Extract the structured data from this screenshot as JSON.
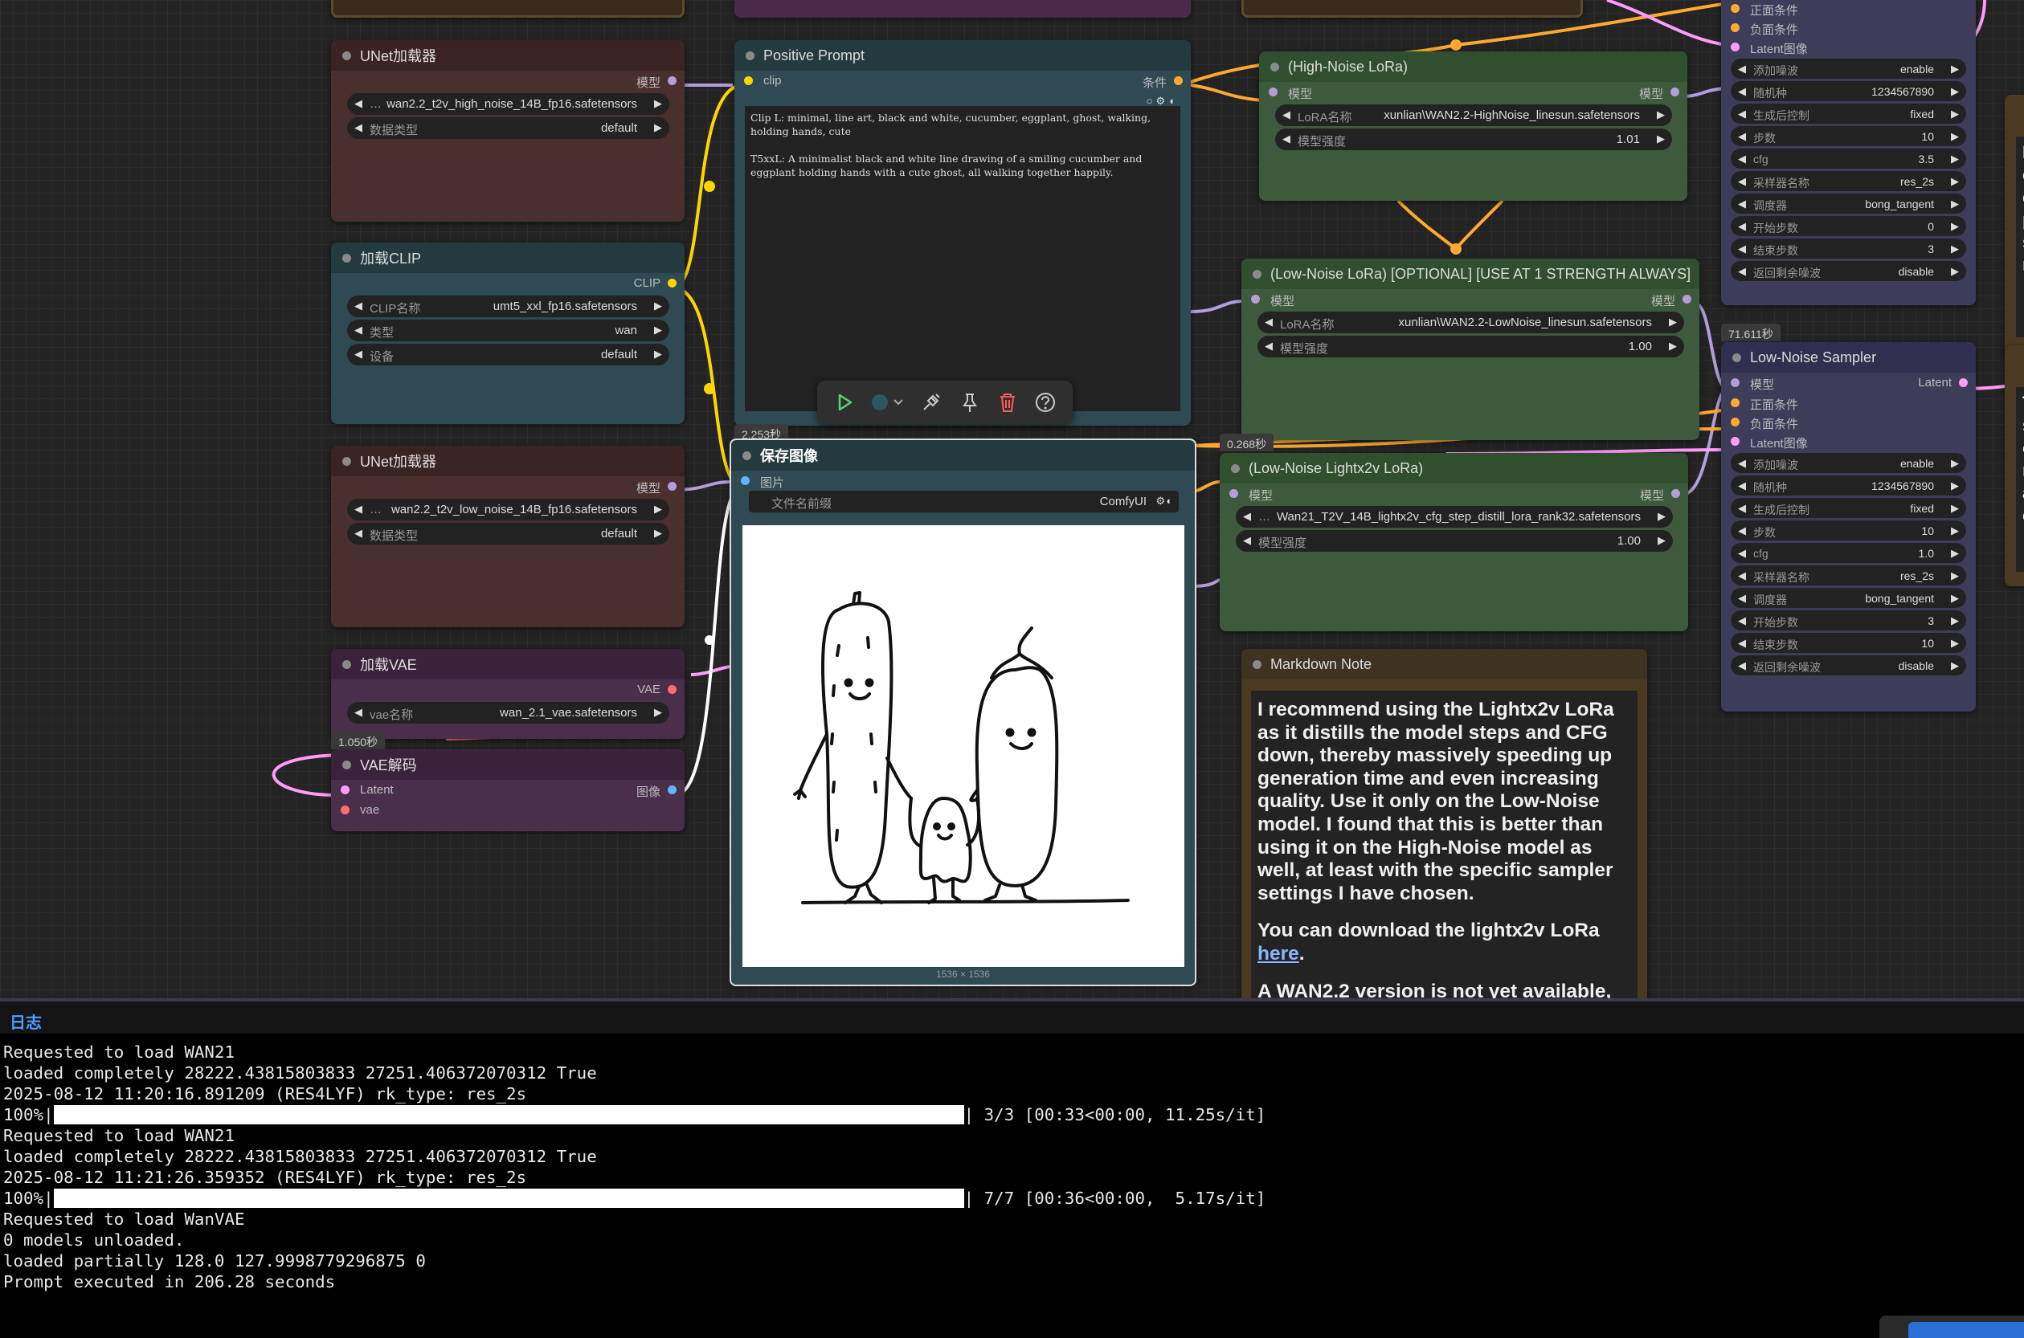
{
  "colors": {
    "clip": "#ffd500",
    "model": "#b39ddb",
    "conditioning": "#ffa931",
    "latent": "#ff9cf9",
    "vae": "#ff6e6e",
    "image": "#64b5f6",
    "green_node": "#2f4f2f",
    "purple_node": "#2f2f4f",
    "red_node": "#3a2323",
    "teal_node": "#233a3f"
  },
  "nodes": {
    "unet_high": {
      "title": "UNet加载器",
      "out_model": "模型",
      "unet_name": "wan2.2_t2v_high_noise_14B_fp16.safetensors",
      "dtype_label": "数据类型",
      "dtype": "default"
    },
    "clip_loader": {
      "title": "加载CLIP",
      "out_clip": "CLIP",
      "clip_name_label": "CLIP名称",
      "clip_name": "umt5_xxl_fp16.safetensors",
      "type_label": "类型",
      "type": "wan",
      "device_label": "设备",
      "device": "default"
    },
    "unet_low": {
      "title": "UNet加载器",
      "out_model": "模型",
      "unet_name": "wan2.2_t2v_low_noise_14B_fp16.safetensors",
      "dtype_label": "数据类型",
      "dtype": "default"
    },
    "vae_loader": {
      "title": "加载VAE",
      "out_vae": "VAE",
      "vae_name_label": "vae名称",
      "vae_name": "wan_2.1_vae.safetensors",
      "time": "1.050秒"
    },
    "vae_decode": {
      "title": "VAE解码",
      "in_latent": "Latent",
      "in_vae": "vae",
      "out_image": "图像"
    },
    "positive_prompt": {
      "title": "Positive Prompt",
      "in_clip": "clip",
      "out_cond": "条件",
      "text": "Clip L: minimal, line art, black and white, cucumber, eggplant, ghost, walking, holding hands, cute\n\nT5xxL: A minimalist black and white line drawing of a smiling cucumber and eggplant holding hands with a cute ghost, all walking together happily."
    },
    "save_image": {
      "title": "保存图像",
      "in_images": "图片",
      "prefix_label": "文件名前缀",
      "prefix": "ComfyUI",
      "dims": "1536 × 1536",
      "time": "2.253秒"
    },
    "high_lora": {
      "title": "(High-Noise LoRa)",
      "in_model": "模型",
      "out_model": "模型",
      "lora_label": "LoRA名称",
      "lora_name": "xunlian\\WAN2.2-HighNoise_linesun.safetensors",
      "strength_label": "模型强度",
      "strength": "1.01"
    },
    "low_lora": {
      "title": "(Low-Noise LoRa) [OPTIONAL] [USE AT 1 STRENGTH ALWAYS]",
      "in_model": "模型",
      "out_model": "模型",
      "lora_label": "LoRA名称",
      "lora_name": "xunlian\\WAN2.2-LowNoise_linesun.safetensors",
      "strength_label": "模型强度",
      "strength": "1.00"
    },
    "lightx2v": {
      "title": "(Low-Noise Lightx2v LoRa)",
      "in_model": "模型",
      "out_model": "模型",
      "lora_name": "Wan21_T2V_14B_lightx2v_cfg_step_distill_lora_rank32.safetensors",
      "strength_label": "模型强度",
      "strength": "1.00",
      "time": "0.268秒"
    },
    "markdown": {
      "title": "Markdown Note",
      "p1": "I recommend using the Lightx2v LoRa as it distills the model steps and CFG down, thereby massively speeding up generation time and even increasing quality. Use it only on the Low-Noise model. I found that this is better than using it on the High-Noise model as well, at least with the specific sampler settings I have chosen.",
      "p2_pre": "You can download the lightx2v LoRa ",
      "p2_link": "here",
      "p2_post": ".",
      "p3": "A WAN2.2 version is not yet available,"
    },
    "sampler_high": {
      "inputs": [
        "正面条件",
        "负面条件",
        "Latent图像"
      ],
      "params": [
        [
          "添加噪波",
          "enable"
        ],
        [
          "随机种",
          "1234567890"
        ],
        [
          "生成后控制",
          "fixed"
        ],
        [
          "步数",
          "10"
        ],
        [
          "cfg",
          "3.5"
        ],
        [
          "采样器名称",
          "res_2s"
        ],
        [
          "调度器",
          "bong_tangent"
        ],
        [
          "开始步数",
          "0"
        ],
        [
          "结束步数",
          "3"
        ],
        [
          "返回剩余噪波",
          "disable"
        ]
      ]
    },
    "sampler_low": {
      "title": "Low-Noise Sampler",
      "time": "71.611秒",
      "in_model": "模型",
      "out_latent": "Latent",
      "inputs": [
        "正面条件",
        "负面条件",
        "Latent图像"
      ],
      "params": [
        [
          "添加噪波",
          "enable"
        ],
        [
          "随机种",
          "1234567890"
        ],
        [
          "生成后控制",
          "fixed"
        ],
        [
          "步数",
          "10"
        ],
        [
          "cfg",
          "1.0"
        ],
        [
          "采样器名称",
          "res_2s"
        ],
        [
          "调度器",
          "bong_tangent"
        ],
        [
          "开始步数",
          "3"
        ],
        [
          "结束步数",
          "10"
        ],
        [
          "返回剩余噪波",
          "disable"
        ]
      ]
    },
    "right_edge_1": {
      "text": [
        "I",
        "c",
        "c",
        "p",
        "s",
        "r"
      ]
    },
    "right_edge_2": {
      "text": [
        "T",
        "s",
        "c",
        "r",
        "a",
        "c"
      ]
    }
  },
  "toolbar": {
    "icons": [
      "play-icon",
      "color-icon",
      "bypass-icon",
      "pin-icon",
      "delete-icon",
      "help-icon"
    ]
  },
  "log": {
    "tab": "日志",
    "lines": [
      "Requested to load WAN21",
      "loaded completely 28222.43815803833 27251.406372070312 True",
      "2025-08-12 11:20:16.891209 (RES4LYF) rk_type: res_2s",
      {
        "pct": "100%|",
        "tail": "| 3/3 [00:33<00:00, 11.25s/it]"
      },
      "Requested to load WAN21",
      "loaded completely 28222.43815803833 27251.406372070312 True",
      "2025-08-12 11:21:26.359352 (RES4LYF) rk_type: res_2s",
      {
        "pct": "100%|",
        "tail": "| 7/7 [00:36<00:00,  5.17s/it]"
      },
      "Requested to load WanVAE",
      "0 models unloaded.",
      "loaded partially 128.0 127.9998779296875 0",
      "Prompt executed in 206.28 seconds"
    ]
  }
}
